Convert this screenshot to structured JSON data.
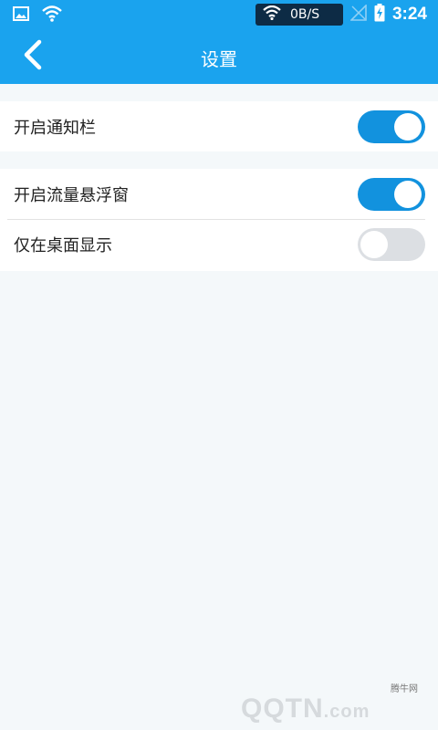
{
  "status_bar": {
    "net_speed": "0B/S",
    "time": "3:24",
    "icons": [
      "image-icon",
      "wifi-icon",
      "wifi-icon",
      "signal-icon",
      "battery-charging-icon"
    ]
  },
  "app_bar": {
    "title": "设置",
    "back_icon": "chevron-left-icon"
  },
  "settings": [
    {
      "label": "开启通知栏",
      "enabled": true
    },
    {
      "label": "开启流量悬浮窗",
      "enabled": true
    },
    {
      "label": "仅在桌面显示",
      "enabled": false
    }
  ],
  "watermark": {
    "site_cn": "腾牛网",
    "logo_text": "QQTN",
    "logo_suffix": ".com"
  },
  "colors": {
    "primary": "#1aa3ee",
    "toggle_on": "#1292de",
    "toggle_off": "#dcdfe3",
    "background": "#f4f8fa"
  }
}
